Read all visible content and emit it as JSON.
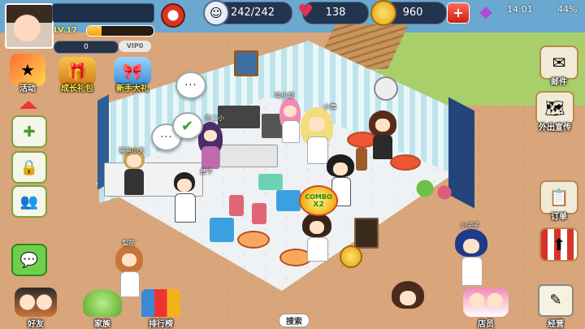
{
  "status_bar": {
    "signal": "4G",
    "time": "14:01",
    "battery": "44%"
  },
  "player": {
    "level": "LV.17",
    "xp_fraction": 0.22,
    "roses": "0",
    "vip": "VIP0"
  },
  "resources": {
    "energy": "242/242",
    "hearts": "138",
    "coins": "960",
    "plus": "+"
  },
  "top_menu": {
    "events": "活动",
    "growth_pack": "成长礼包",
    "newbie_gift": "新手大礼"
  },
  "right_menu": {
    "mail": "邮件",
    "promote": "外出宣传",
    "orders": "订单",
    "shop_upgrade": "",
    "manage": "经营"
  },
  "bottom_menu": {
    "friends": "好友",
    "family": "家族",
    "ranking": "排行榜",
    "search": "搜索",
    "staff": "店员",
    "manage": "经营"
  },
  "scene": {
    "combo_line1": "COMBO",
    "combo_line2": "X2",
    "bubble_text": "···",
    "check_mark": "✔",
    "name_tags": [
      "南二小",
      "喵小姐",
      "小舞",
      "爸爸小天",
      "黄千",
      "梨花",
      "帅",
      "小尖子"
    ]
  },
  "colors": {
    "accent": "#f2b21b",
    "hud_bg": "#23344e",
    "button_border": "#7aa33a"
  }
}
